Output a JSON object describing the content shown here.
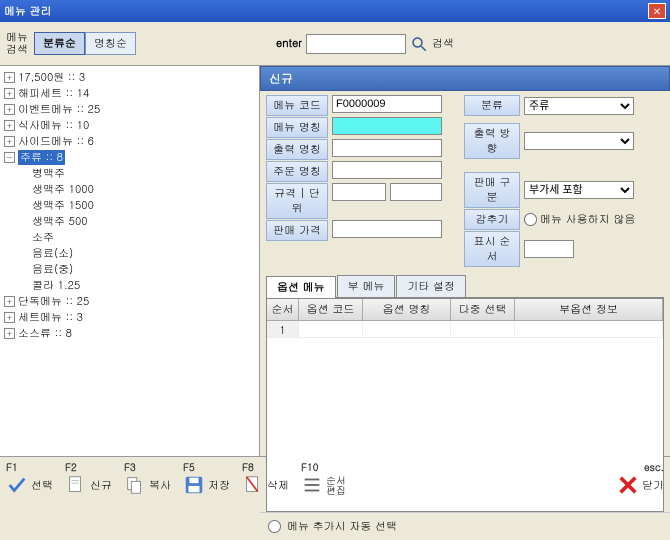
{
  "window": {
    "title": "메뉴 관리"
  },
  "topbar": {
    "search_vert_label": "메뉴\n검색",
    "sort_category": "분류순",
    "sort_name": "명칭순",
    "enter_label": "enter",
    "search_btn_label": "검색"
  },
  "tree": {
    "items": [
      {
        "label": "17,500원 :: 3",
        "exp": false
      },
      {
        "label": "해피세트 :: 14",
        "exp": false
      },
      {
        "label": "이벤트메뉴 :: 25",
        "exp": false
      },
      {
        "label": "식사메뉴 :: 10",
        "exp": false
      },
      {
        "label": "사이드메뉴 :: 6",
        "exp": false
      },
      {
        "label": "주류 :: 8",
        "exp": true,
        "children": [
          "병맥주",
          "생맥주 1000",
          "생맥주 1500",
          "생맥주 500",
          "소주",
          "음료(소)",
          "음료(중)",
          "콜라 1.25"
        ]
      },
      {
        "label": "단독메뉴 :: 25",
        "exp": false
      },
      {
        "label": "세트메뉴 :: 3",
        "exp": false
      },
      {
        "label": "소스류 :: 8",
        "exp": false
      }
    ]
  },
  "panel": {
    "title": "신규"
  },
  "form": {
    "labels": {
      "menu_code": "메뉴 코드",
      "menu_name": "메뉴 명칭",
      "print_name": "출력 명칭",
      "order_name": "주문 명칭",
      "spec_unit": "규격 | 단위",
      "sale_price": "판매 가격",
      "category": "분류",
      "print_dir": "출력 방향",
      "sale_div": "판매 구분",
      "subtract": "감추기",
      "disp_order": "표시 순서"
    },
    "values": {
      "menu_code": "F0000009",
      "menu_name": "",
      "print_name": "",
      "order_name": "",
      "spec": "",
      "unit": "",
      "sale_price": "",
      "category": "주류",
      "print_dir": "",
      "sale_div": "부가세 포함",
      "disp_order": ""
    },
    "radio_unused": "메뉴 사용하지 않음"
  },
  "tabs": {
    "t1": "옵션 메뉴",
    "t2": "부 메뉴",
    "t3": "기타 설정"
  },
  "grid": {
    "headers": {
      "c0": "순서",
      "c1": "옵션 코드",
      "c2": "옵션 명칭",
      "c3": "다중 선택",
      "c4": "부옵션 정보"
    },
    "rows": [
      {
        "idx": "1"
      }
    ]
  },
  "bottom": {
    "auto_select": "메뉴 추가시 자동 선택"
  },
  "fnbar": {
    "f1": {
      "key": "F1",
      "label": "선택"
    },
    "f2": {
      "key": "F2",
      "label": "신규"
    },
    "f3": {
      "key": "F3",
      "label": "복사"
    },
    "f5": {
      "key": "F5",
      "label": "저장"
    },
    "f8": {
      "key": "F8",
      "label": "삭제"
    },
    "f10": {
      "key": "F10",
      "label": "순서\n편집"
    },
    "esc": {
      "key": "esc.",
      "label": "닫기"
    }
  }
}
